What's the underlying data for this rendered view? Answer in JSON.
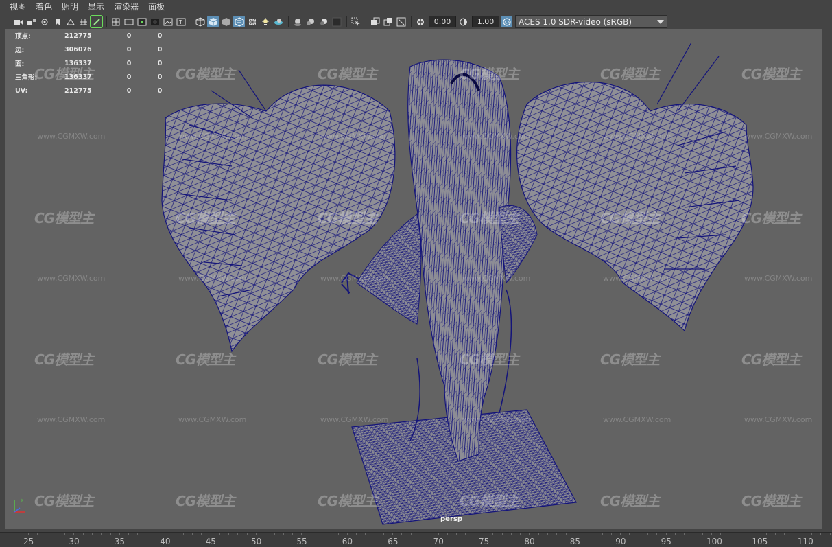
{
  "menu": [
    "视图",
    "着色",
    "照明",
    "显示",
    "渲染器",
    "面板"
  ],
  "toolbar": {
    "icons": [
      "camera-icon",
      "camera-lock-icon",
      "camera-attributes-icon",
      "bookmark-icon",
      "image-plane-icon",
      "grid-icon",
      "film-gate-icon",
      "resolution-gate-icon",
      "gate-mask-icon",
      "field-chart-icon",
      "safe-action-icon",
      "safe-title-icon",
      "wireframe-icon",
      "smooth-shade-icon",
      "default-material-icon",
      "textured-icon",
      "use-all-lights-icon",
      "shadows-icon",
      "ambient-occlusion-icon",
      "motion-blur-icon",
      "anti-aliasing-icon",
      "depth-of-field-icon",
      "isolate-select-icon",
      "xray-icon",
      "xray-joints-icon",
      "xray-active-icon",
      "exposure-icon",
      "gamma-icon",
      "color-management-icon"
    ],
    "exposure": "0.00",
    "gamma": "1.00",
    "color_space": "ACES 1.0 SDR-video (sRGB)"
  },
  "stats": {
    "headers": [
      "顶点:",
      "边:",
      "面:",
      "三角形:",
      "UV:"
    ],
    "rows": [
      [
        "顶点:",
        "212775",
        "0",
        "0"
      ],
      [
        "边:",
        "306076",
        "0",
        "0"
      ],
      [
        "面:",
        "136337",
        "0",
        "0"
      ],
      [
        "三角形:",
        "136337",
        "0",
        "0"
      ],
      [
        "UV:",
        "212775",
        "0",
        "0"
      ]
    ]
  },
  "watermark": {
    "logo": "CG模型主",
    "url": "www.CGMXW.com"
  },
  "camera_label": "persp",
  "ruler": [
    "25",
    "30",
    "35",
    "40",
    "45",
    "50",
    "55",
    "60",
    "65",
    "70",
    "75",
    "80",
    "85",
    "90",
    "95",
    "100",
    "105",
    "110"
  ],
  "colors": {
    "viewport_bg": "#636363",
    "wire": "#14147a",
    "mesh_fill": "#8d8d95",
    "accent_active": "#5d8fb5",
    "highlight_green": "#6adb5b"
  }
}
